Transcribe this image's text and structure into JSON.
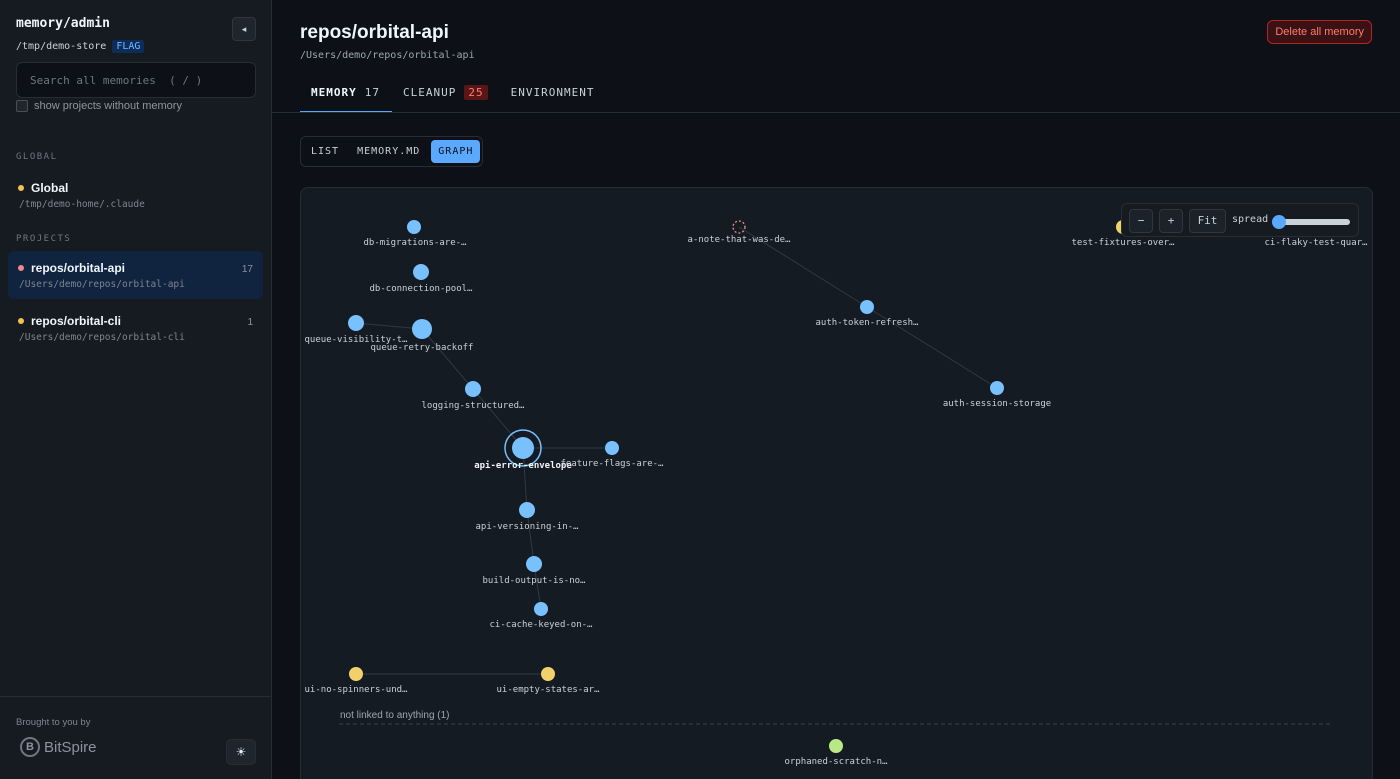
{
  "sidebar": {
    "title": "memory/admin",
    "store_path": "/tmp/demo-store",
    "store_flag": "FLAG",
    "collapse_icon": "◂",
    "search_placeholder": "Search all memories  ( / )",
    "show_empty_label": "show projects without memory",
    "global_section": "GLOBAL",
    "global": {
      "name": "Global",
      "path": "/tmp/demo-home/.claude",
      "color": "#f2c14e"
    },
    "projects_section": "PROJECTS",
    "projects": [
      {
        "name": "repos/orbital-api",
        "path": "/Users/demo/repos/orbital-api",
        "count": "17",
        "color": "#f08a8a",
        "active": true
      },
      {
        "name": "repos/orbital-cli",
        "path": "/Users/demo/repos/orbital-cli",
        "count": "1",
        "color": "#f2c14e",
        "active": false
      }
    ],
    "credit": "Brought to you by",
    "logo_text": "BitSpire",
    "theme_icon": "☀"
  },
  "header": {
    "title": "repos/orbital-api",
    "path": "/Users/demo/repos/orbital-api",
    "delete_label": "Delete all memory"
  },
  "tabs": [
    {
      "label": "MEMORY",
      "count": "17"
    },
    {
      "label": "CLEANUP",
      "count": "25"
    },
    {
      "label": "ENVIRONMENT",
      "count": ""
    }
  ],
  "views": [
    "LIST",
    "MEMORY.MD",
    "GRAPH"
  ],
  "controls": {
    "zoom_out": "−",
    "zoom_in": "+",
    "fit": "Fit",
    "spread_label": "spread",
    "spread_value": 0
  },
  "colors": {
    "memory": "#79c0ff",
    "feedback": "#f2d06b",
    "orphan": "#b8e986",
    "missing": "#f08a8a",
    "accent": "#58a6ff"
  },
  "graph": {
    "nodes": [
      {
        "id": "db-migrations",
        "label": "db-migrations-are-…",
        "kind": "memory"
      },
      {
        "id": "a-note",
        "label": "a-note-that-was-de…",
        "kind": "missing"
      },
      {
        "id": "test-fixtures",
        "label": "test-fixtures-over…",
        "kind": "feedback"
      },
      {
        "id": "ci-flaky",
        "label": "ci-flaky-test-quar…",
        "kind": "memory"
      },
      {
        "id": "db-connection",
        "label": "db-connection-pool…",
        "kind": "memory"
      },
      {
        "id": "auth-token",
        "label": "auth-token-refresh…",
        "kind": "memory"
      },
      {
        "id": "queue-visibility",
        "label": "queue-visibility-t…",
        "kind": "memory"
      },
      {
        "id": "queue-retry",
        "label": "queue-retry-backoff",
        "kind": "memory"
      },
      {
        "id": "logging",
        "label": "logging-structured…",
        "kind": "memory"
      },
      {
        "id": "auth-session",
        "label": "auth-session-storage",
        "kind": "memory"
      },
      {
        "id": "api-error",
        "label": "api-error-envelope",
        "kind": "memory",
        "selected": true
      },
      {
        "id": "feature-flags",
        "label": "feature-flags-are-…",
        "kind": "memory"
      },
      {
        "id": "api-versioning",
        "label": "api-versioning-in-…",
        "kind": "memory"
      },
      {
        "id": "build-output",
        "label": "build-output-is-no…",
        "kind": "memory"
      },
      {
        "id": "ci-cache",
        "label": "ci-cache-keyed-on-…",
        "kind": "memory"
      },
      {
        "id": "ui-no-spinners",
        "label": "ui-no-spinners-und…",
        "kind": "feedback"
      },
      {
        "id": "ui-empty-states",
        "label": "ui-empty-states-ar…",
        "kind": "feedback"
      },
      {
        "id": "orphaned-scratch",
        "label": "orphaned-scratch-n…",
        "kind": "orphan"
      }
    ],
    "edges": [
      [
        "queue-visibility",
        "queue-retry"
      ],
      [
        "queue-retry",
        "logging"
      ],
      [
        "logging",
        "api-error"
      ],
      [
        "api-error",
        "feature-flags"
      ],
      [
        "api-error",
        "api-versioning"
      ],
      [
        "api-versioning",
        "build-output"
      ],
      [
        "build-output",
        "ci-cache"
      ],
      [
        "a-note",
        "auth-token"
      ],
      [
        "auth-token",
        "auth-session"
      ],
      [
        "ui-no-spinners",
        "ui-empty-states"
      ]
    ],
    "orphan_label": "not linked to anything (1)"
  }
}
